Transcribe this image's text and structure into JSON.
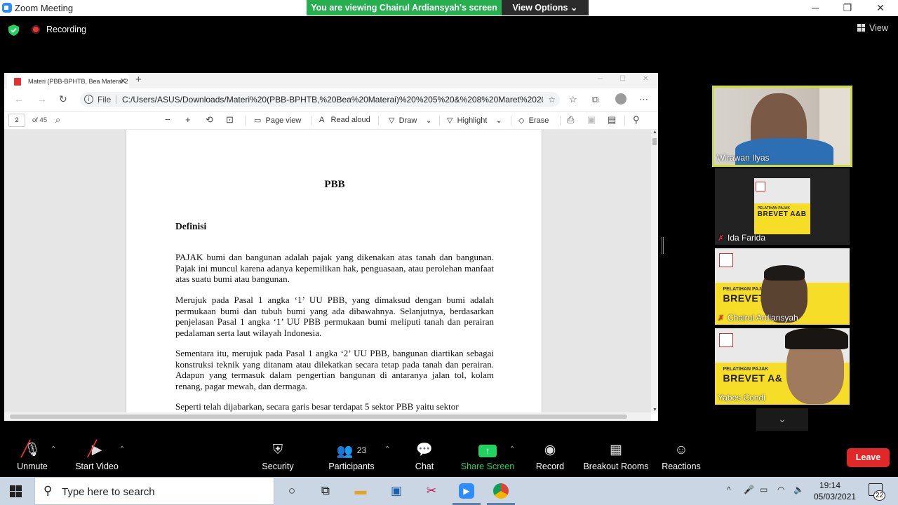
{
  "window": {
    "title": "Zoom Meeting",
    "minimize": "─",
    "maximize": "❐",
    "close": "✕"
  },
  "share_banner": {
    "text": "You are viewing Chairul Ardiansyah's screen",
    "view_options": "View Options ⌄"
  },
  "meeting_bar": {
    "recording_label": "Recording",
    "view_label": "View"
  },
  "browser": {
    "tab_title": "Materi (PBB-BPHTB, Bea Materai 2",
    "url_prefix": "File",
    "url": "C:/Users/ASUS/Downloads/Materi%20(PBB-BPHTB,%20Bea%20Materai)%20%205%20&%208%20Maret%202021....",
    "pdf_toolbar": {
      "page_number": "2",
      "page_total": "of 45",
      "page_view": "Page view",
      "read_aloud": "Read aloud",
      "draw": "Draw",
      "highlight": "Highlight",
      "erase": "Erase"
    }
  },
  "document": {
    "title": "PBB",
    "heading": "Definisi",
    "paragraphs": [
      "PAJAK bumi dan bangunan adalah pajak yang dikenakan atas tanah dan bangunan. Pajak ini muncul karena adanya kepemilikan hak, penguasaan, atau perolehan manfaat atas suatu bumi atau bangunan.",
      "Merujuk pada Pasal 1 angka ‘1’ UU PBB, yang dimaksud dengan bumi adalah permukaan bumi dan tubuh bumi yang ada dibawahnya. Selanjutnya, berdasarkan penjelasan Pasal 1 angka ‘1’ UU PBB permukaan bumi meliputi tanah dan perairan pedalaman serta laut wilayah Indonesia.",
      "Sementara itu, merujuk pada Pasal 1 angka ‘2’ UU PBB, bangunan diartikan sebagai konstruksi teknik yang ditanam atau dilekatkan secara tetap pada tanah dan perairan. Adapun yang termasuk dalam pengertian bangunan di antaranya jalan tol, kolam renang, pagar mewah, dan dermaga.",
      "Seperti telah dijabarkan, secara garis besar terdapat 5 sektor PBB yaitu sektor"
    ]
  },
  "participants": [
    {
      "name": "Wirawan Ilyas",
      "muted": false,
      "active_speaker": true
    },
    {
      "name": "Ida Farida",
      "muted": true,
      "poster_title": "PELATIHAN PAJAK",
      "poster_brand": "BREVET A&B"
    },
    {
      "name": "Chairul Ardiansyah",
      "muted": true,
      "poster_title": "PELATIHAN PAJAK",
      "poster_brand": "BREVET"
    },
    {
      "name": "Yabes Condi",
      "muted": false,
      "poster_title": "PELATIHAN PAJAK",
      "poster_brand": "BREVET A&"
    }
  ],
  "controls": {
    "unmute": "Unmute",
    "start_video": "Start Video",
    "security": "Security",
    "participants": "Participants",
    "participant_count": "23",
    "chat": "Chat",
    "share_screen": "Share Screen",
    "record": "Record",
    "breakout_rooms": "Breakout Rooms",
    "reactions": "Reactions",
    "leave": "Leave"
  },
  "colors": {
    "share_green": "#23d160",
    "banner_green": "#27ae4f",
    "leave_red": "#e02828",
    "speaker_border": "#cddc39"
  },
  "taskbar": {
    "search_placeholder": "Type here to search",
    "time": "19:14",
    "date": "05/03/2021",
    "notification_count": "22"
  }
}
